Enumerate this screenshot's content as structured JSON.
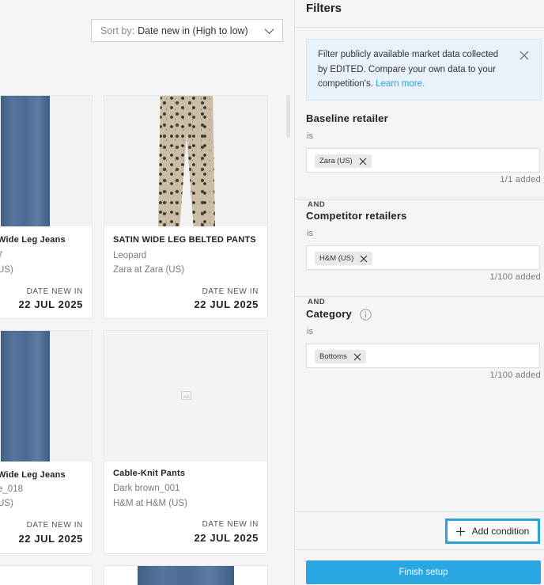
{
  "sort": {
    "label": "Sort by:",
    "value": "Date new in (High to low)"
  },
  "products": [
    {
      "title": "Wide Leg Jeans",
      "line1": "7",
      "line2": "US)",
      "date_label": "DATE NEW IN",
      "date": "22 JUL 2025"
    },
    {
      "title": "SATIN WIDE LEG BELTED PANTS",
      "line1": "Leopard",
      "line2": "Zara at Zara (US)",
      "date_label": "DATE NEW IN",
      "date": "22 JUL 2025"
    },
    {
      "title": "Wide Leg Jeans",
      "line1": "e_018",
      "line2": "US)",
      "date_label": "DATE NEW IN",
      "date": "22 JUL 2025"
    },
    {
      "title": "Cable-Knit Pants",
      "line1": "Dark brown_001",
      "line2": "H&M at H&M (US)",
      "date_label": "DATE NEW IN",
      "date": "22 JUL 2025"
    }
  ],
  "filters": {
    "title": "Filters",
    "info": {
      "text": "Filter publicly available market data collected by EDITED. Compare your own data to your competition's.",
      "link": "Learn more."
    },
    "and_label": "AND",
    "sections": [
      {
        "title": "Baseline retailer",
        "op": "is",
        "chip": "Zara (US)",
        "count": "1/1 added"
      },
      {
        "title": "Competitor retailers",
        "op": "is",
        "chip": "H&M (US)",
        "count": "1/100 added"
      },
      {
        "title": "Category",
        "op": "is",
        "chip": "Bottoms",
        "count": "1/100 added"
      }
    ],
    "add_condition": "Add condition",
    "finish": "Finish setup"
  },
  "colors": {
    "accent": "#2aa6e3",
    "info_bg": "#e9f2fb"
  }
}
